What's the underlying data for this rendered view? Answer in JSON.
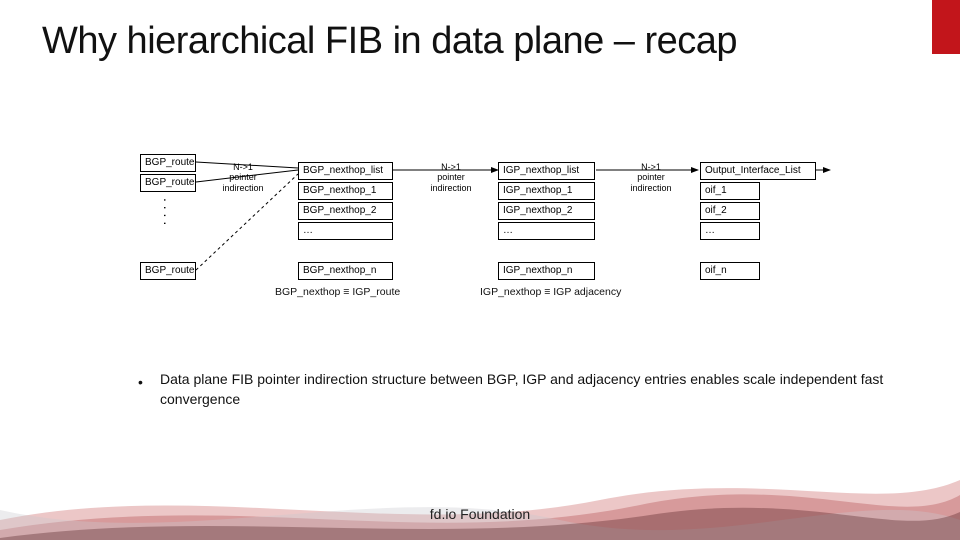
{
  "title": "Why hierarchical FIB in data plane – recap",
  "footer": "fd.io Foundation",
  "bullet": "Data plane FIB pointer indirection structure between BGP, IGP and adjacency entries enables scale independent fast convergence",
  "col_routes": {
    "r1": "BGP_route",
    "r2": "BGP_route",
    "rN": "BGP_route",
    "vdots": ". . . ."
  },
  "indir1": {
    "l1": "N->1",
    "l2": "pointer",
    "l3": "indirection"
  },
  "indir2": {
    "l1": "N->1",
    "l2": "pointer",
    "l3": "indirection"
  },
  "indir3": {
    "l1": "N->1",
    "l2": "pointer",
    "l3": "indirection"
  },
  "bgp_list": {
    "head": "BGP_nexthop_list",
    "i1": "BGP_nexthop_1",
    "i2": "BGP_nexthop_2",
    "ell": "…",
    "iN": "BGP_nexthop_n",
    "caption": "BGP_nexthop ≡ IGP_route"
  },
  "igp_list": {
    "head": "IGP_nexthop_list",
    "i1": "IGP_nexthop_1",
    "i2": "IGP_nexthop_2",
    "ell": "…",
    "iN": "IGP_nexthop_n",
    "caption": "IGP_nexthop ≡ IGP adjacency"
  },
  "oif_list": {
    "head": "Output_Interface_List",
    "i1": "oif_1",
    "i2": "oif_2",
    "ell": "…",
    "iN": "oif_n"
  }
}
